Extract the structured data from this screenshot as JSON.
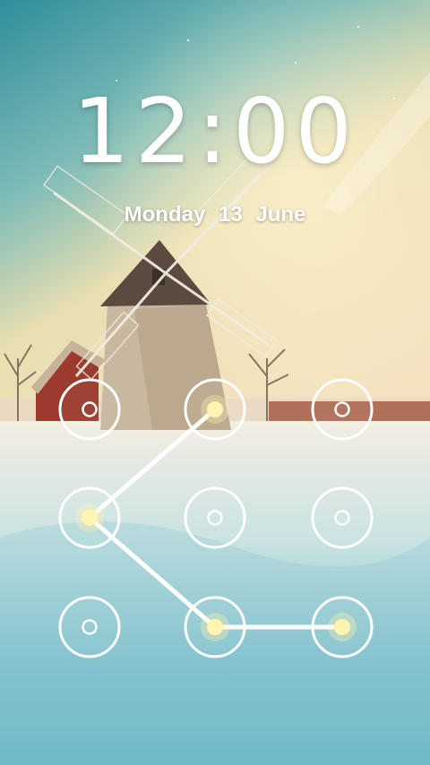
{
  "lockscreen": {
    "time": "12:00",
    "date": {
      "weekday": "Monday",
      "day": "13",
      "month": "June"
    }
  },
  "pattern": {
    "selected_path": [
      2,
      4,
      8,
      9
    ],
    "dot_color": "#fff4b0",
    "ring_color": "#ffffff",
    "line_color": "#ffffff"
  }
}
